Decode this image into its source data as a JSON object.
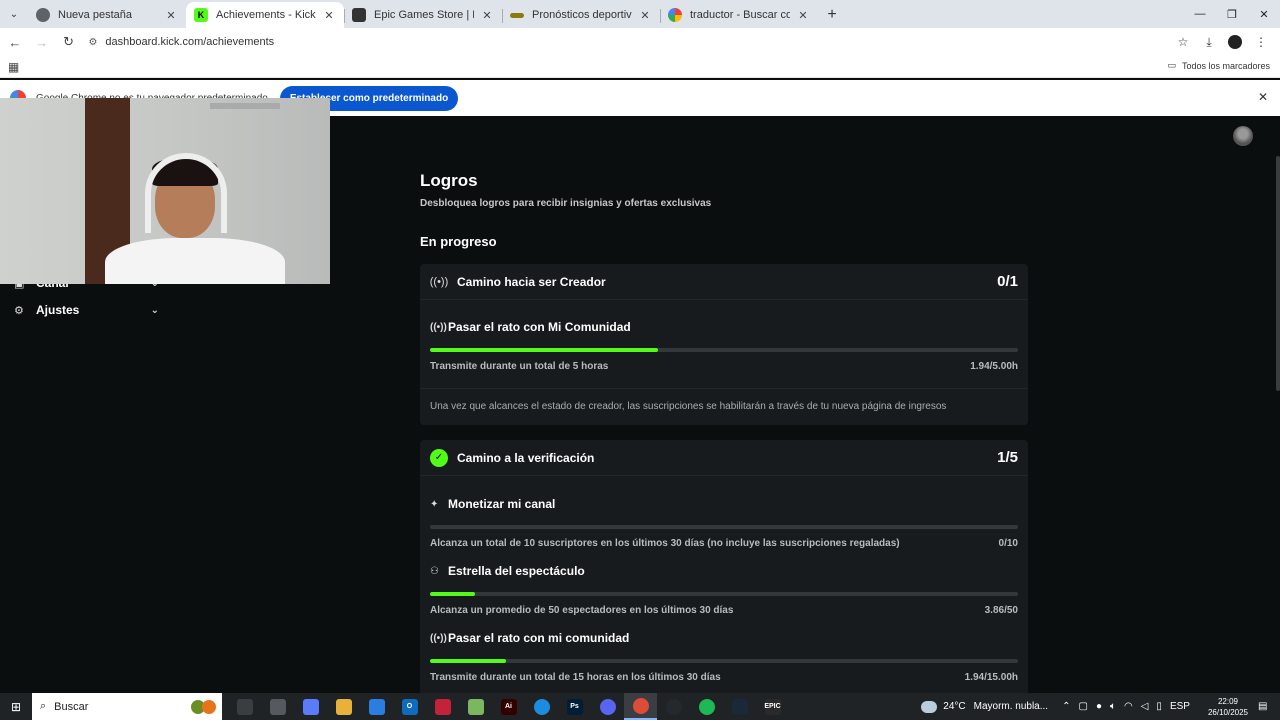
{
  "browser": {
    "tabs": [
      {
        "title": "Nueva pestaña",
        "icon": "chrome-newtab-icon",
        "color": "#5f6368",
        "active": false
      },
      {
        "title": "Achievements - Kick Dashboard",
        "icon": "kick-icon",
        "color": "#53fc18",
        "active": true
      },
      {
        "title": "Epic Games Store | Descarga y j",
        "icon": "epic-icon",
        "color": "#333333",
        "active": false
      },
      {
        "title": "Pronósticos deportivos | Juegos",
        "icon": "sports-icon",
        "color": "#8a7a10",
        "active": false
      },
      {
        "title": "traductor - Buscar con Google",
        "icon": "google-icon",
        "color": "#4285f4",
        "active": false
      }
    ],
    "url": "dashboard.kick.com/achievements",
    "bookmarks_all": "Todos los marcadores",
    "infobar": {
      "message": "Google Chrome no es tu navegador predeterminado",
      "button": "Establecer como predeterminado"
    }
  },
  "sidebar": {
    "items": [
      {
        "label": "Canal",
        "icon": "channel-icon"
      },
      {
        "label": "Ajustes",
        "icon": "gear-icon"
      }
    ]
  },
  "main": {
    "title": "Logros",
    "subtitle": "Desbloquea logros para recibir insignias y ofertas exclusivas",
    "section": "En progreso",
    "cards": [
      {
        "title": "Camino hacia ser Creador",
        "count": "0/1",
        "icon": "broadcast-icon",
        "achievements": [
          {
            "title": "Pasar el rato con Mi Comunidad",
            "icon": "broadcast-icon",
            "description": "Transmite durante un total de 5 horas",
            "progress": "1.94/5.00h",
            "fraction": 0.388
          }
        ],
        "note": "Una vez que alcances el estado de creador, las suscripciones se habilitarán a través de tu nueva página de ingresos"
      },
      {
        "title": "Camino a la verificación",
        "count": "1/5",
        "icon": "verified-badge-icon",
        "achievements": [
          {
            "title": "Monetizar mi canal",
            "icon": "sparkle-icon",
            "description": "Alcanza un total de 10 suscriptores en los últimos 30 días (no incluye las suscripciones regaladas)",
            "progress": "0/10",
            "fraction": 0.0
          },
          {
            "title": "Estrella del espectáculo",
            "icon": "users-icon",
            "description": "Alcanza un promedio de 50 espectadores en los últimos 30 días",
            "progress": "3.86/50",
            "fraction": 0.077
          },
          {
            "title": "Pasar el rato con mi comunidad",
            "icon": "broadcast-icon",
            "description": "Transmite durante un total de 15 horas en los últimos 30 días",
            "progress": "1.94/15.00h",
            "fraction": 0.129
          }
        ]
      }
    ]
  },
  "taskbar": {
    "search_placeholder": "Buscar",
    "weather_temp": "24°C",
    "weather_desc": "Mayorm. nubla...",
    "language": "ESP",
    "time": "22:09",
    "date": "26/10/2025",
    "apps": [
      {
        "name": "task-view-icon",
        "color": "#3a3e42",
        "label": ""
      },
      {
        "name": "widgets-icon",
        "color": "#555a60",
        "label": ""
      },
      {
        "name": "copilot-icon",
        "color": "#5b7cfa",
        "label": ""
      },
      {
        "name": "file-explorer-icon",
        "color": "#e8b23a",
        "label": ""
      },
      {
        "name": "store-icon",
        "color": "#2a7de1",
        "label": ""
      },
      {
        "name": "outlook-icon",
        "color": "#0f6cbd",
        "label": "O"
      },
      {
        "name": "app-red-icon",
        "color": "#c4213b",
        "label": ""
      },
      {
        "name": "maps-app-icon",
        "color": "#7bb661",
        "label": ""
      },
      {
        "name": "illustrator-icon",
        "color": "#330000",
        "label": "Ai"
      },
      {
        "name": "edge-icon",
        "color": "#1b8de0",
        "label": ""
      },
      {
        "name": "photoshop-icon",
        "color": "#001e36",
        "label": "Ps"
      },
      {
        "name": "discord-icon",
        "color": "#5865f2",
        "label": ""
      },
      {
        "name": "chrome-icon",
        "color": "#dd4b39",
        "label": ""
      },
      {
        "name": "github-icon",
        "color": "#24292e",
        "label": ""
      },
      {
        "name": "spotify-icon",
        "color": "#1db954",
        "label": ""
      },
      {
        "name": "steam-icon",
        "color": "#1b2838",
        "label": ""
      },
      {
        "name": "epic-games-icon",
        "color": "#2a2a2a",
        "label": "EPIC"
      }
    ]
  },
  "colors": {
    "accent": "#53fc18",
    "page_bg": "#0b0e0f",
    "card_bg": "#181b1d",
    "chrome_blue": "#0b57d0"
  }
}
